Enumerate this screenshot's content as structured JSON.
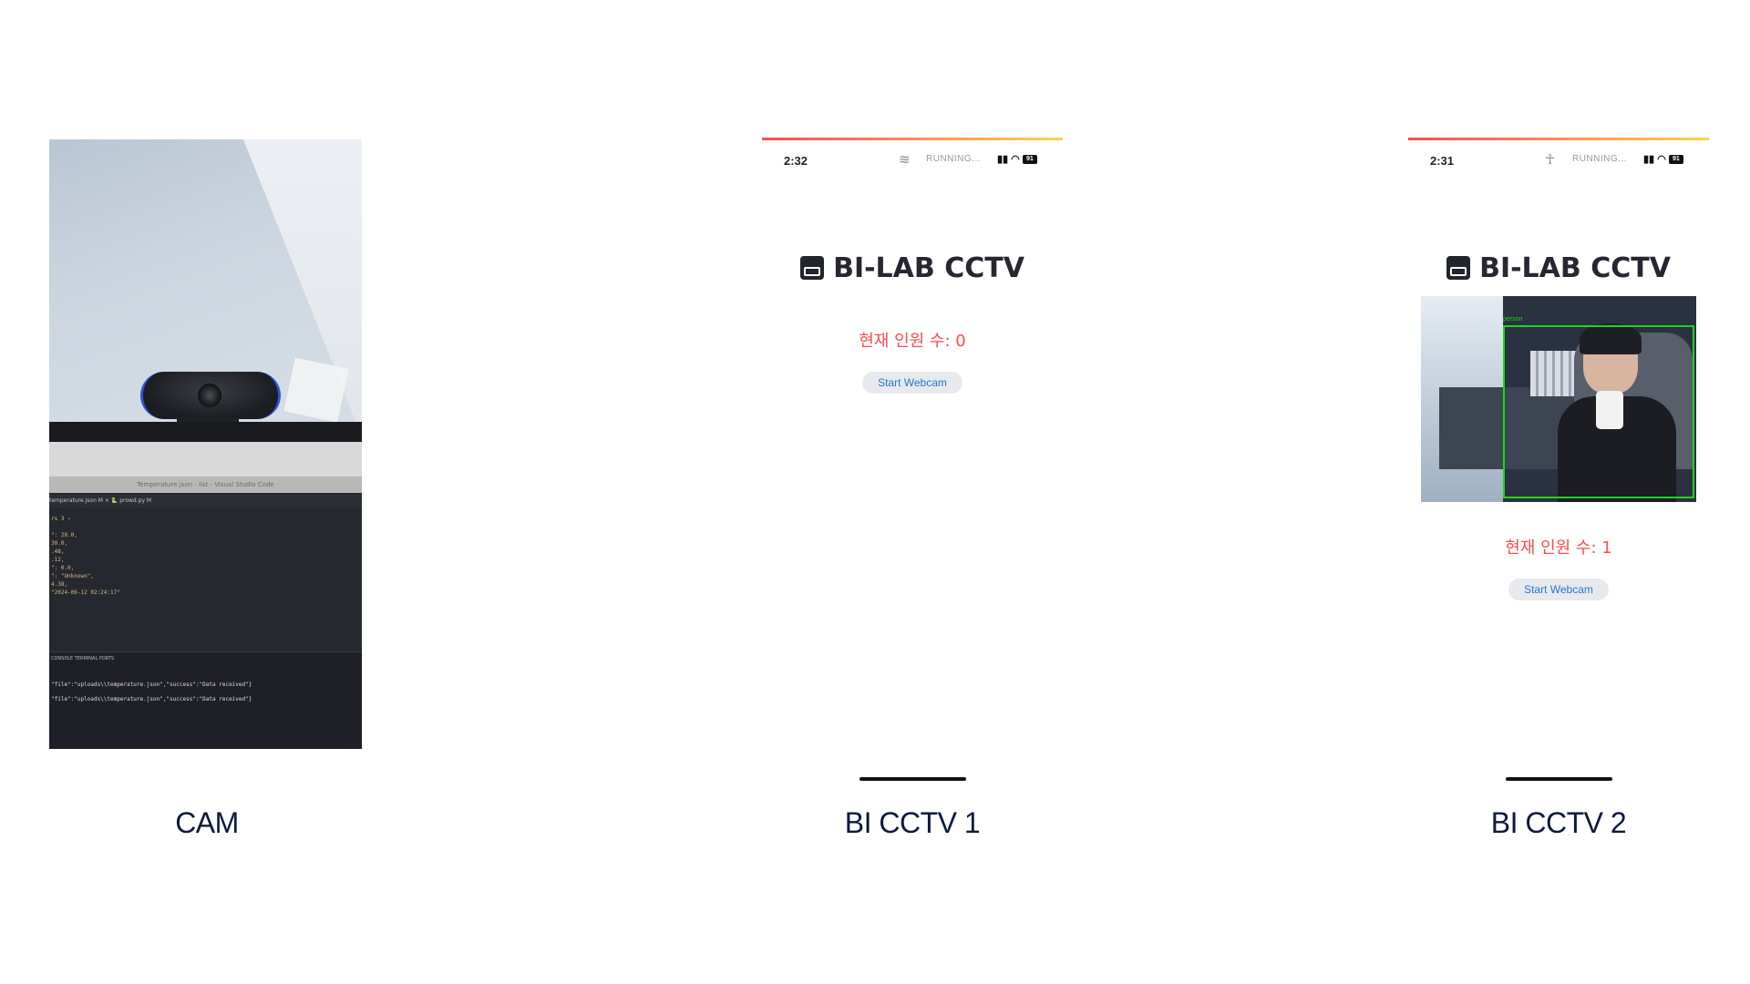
{
  "cam_panel": {
    "caption": "CAM",
    "screen_title": "Temperature.json - list - Visual Studio Code",
    "editor_tabs": "temperature.json M  ×    🐍 prowd.py M",
    "code_lines": "rs 3 ›\n\n\": 28.0,\n30.0,\n.48,\n.12,\n\": 0.0,\n\": \"Unknown\",\n4.38,\n\"2024-06-12 02:24:17\"",
    "terminal_tabs": "CONSOLE     TERMINAL     PORTS",
    "terminal_lines": "\"file\":\"uploads\\\\temperature.json\",\"success\":\"Data received\"}\n\"file\":\"uploads\\\\temperature.json\",\"success\":\"Data received\"}"
  },
  "phone1": {
    "caption": "BI CCTV 1",
    "time": "2:32",
    "status_text": "RUNNING...",
    "status_icon": "swimmer-icon",
    "app_title": "BI-LAB CCTV",
    "count_text": "현재 인원 수: 0",
    "button_label": "Start Webcam"
  },
  "phone2": {
    "caption": "BI CCTV 2",
    "time": "2:31",
    "status_text": "RUNNING...",
    "status_icon": "walker-icon",
    "app_title": "BI-LAB CCTV",
    "detection_label": "person",
    "count_text": "현재 인원 수: 1",
    "button_label": "Start Webcam"
  },
  "colors": {
    "accent": "#ff4b4b",
    "button_text": "#1f77d4",
    "bbox": "#1fd21f",
    "caption": "#0d1a3a"
  }
}
